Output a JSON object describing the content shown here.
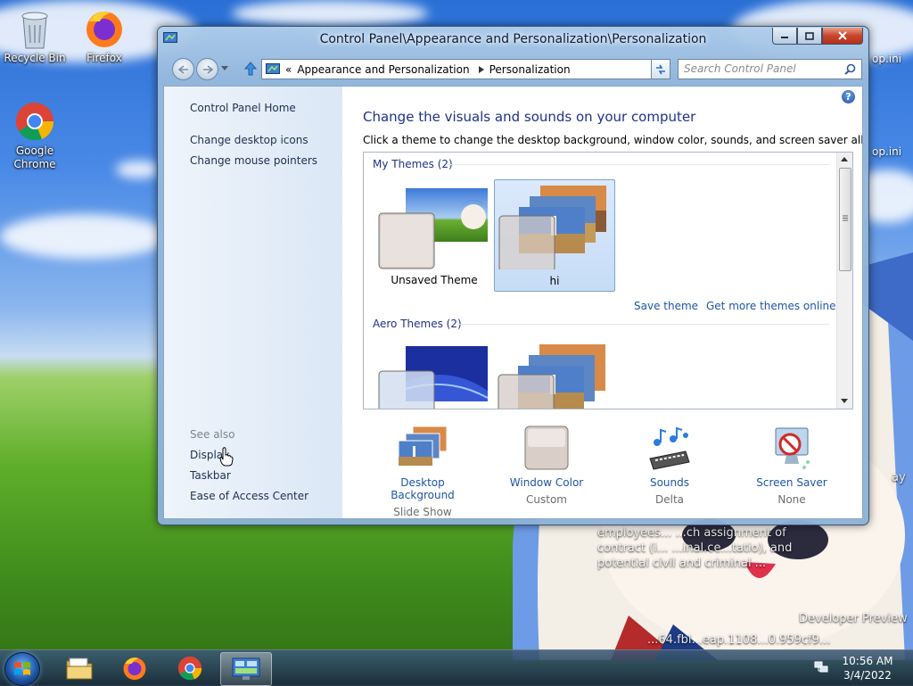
{
  "desktop": {
    "icons": [
      {
        "label": "Recycle Bin",
        "icon": "recycle-bin-icon"
      },
      {
        "label": "Firefox",
        "icon": "firefox-icon"
      },
      {
        "label": "Google Chrome",
        "icon": "chrome-icon"
      }
    ],
    "ini_labels": [
      "op.ini",
      "op.ini"
    ],
    "bg_text_lines": [
      "employees... ...ch assignment of",
      "contract (i... ...inal.ce...tatio), and",
      "potential civil and criminal ...",
      "Developer Preview",
      "...64.fbl...eap.1108...0.959cf9..."
    ],
    "side_text": "ay"
  },
  "window": {
    "title": "Control Panel\\Appearance and Personalization\\Personalization",
    "address": {
      "chevrons": "«",
      "segments": [
        "Appearance and Personalization",
        "Personalization"
      ]
    },
    "search_placeholder": "Search Control Panel",
    "left_pane": {
      "home": "Control Panel Home",
      "links": [
        "Change desktop icons",
        "Change mouse pointers"
      ],
      "see_also_heading": "See also",
      "see_also": [
        "Display",
        "Taskbar",
        "Ease of Access Center"
      ]
    },
    "main": {
      "heading": "Change the visuals and sounds on your computer",
      "subtitle": "Click a theme to change the desktop background, window color, sounds, and screen saver all at once.",
      "groups": [
        {
          "label": "My Themes (2)",
          "themes": [
            "Unsaved Theme",
            "hi"
          ]
        },
        {
          "label": "Aero Themes (2)",
          "themes": [
            "",
            ""
          ]
        }
      ],
      "selected_theme": "hi",
      "save_theme": "Save theme",
      "get_more": "Get more themes online",
      "bottom": [
        {
          "label": "Desktop Background",
          "value": "Slide Show"
        },
        {
          "label": "Window Color",
          "value": "Custom"
        },
        {
          "label": "Sounds",
          "value": "Delta"
        },
        {
          "label": "Screen Saver",
          "value": "None"
        }
      ]
    }
  },
  "taskbar": {
    "time": "10:56 AM",
    "date": "3/4/2022",
    "pinned": [
      "explorer-icon",
      "firefox-icon",
      "chrome-icon",
      "control-panel-icon"
    ]
  },
  "colors": {
    "link": "#1e55a5",
    "heading": "#1e3287",
    "selection": "#c6dcf6"
  }
}
